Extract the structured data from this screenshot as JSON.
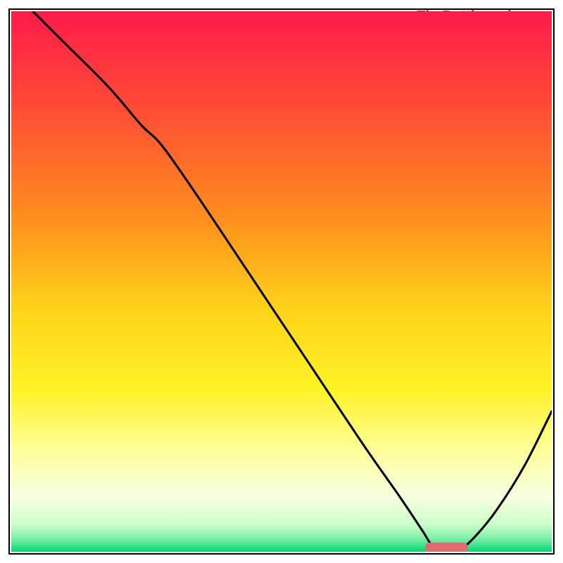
{
  "watermark": "TheBottleneck.com",
  "colors": {
    "frame": "#000000",
    "curve": "#000000",
    "marker": "#e16a6f",
    "gradient_stops": [
      {
        "offset": 0.0,
        "color": "#ff1b4b"
      },
      {
        "offset": 0.18,
        "color": "#ff4c35"
      },
      {
        "offset": 0.38,
        "color": "#ff8e1e"
      },
      {
        "offset": 0.55,
        "color": "#ffd21a"
      },
      {
        "offset": 0.7,
        "color": "#fff326"
      },
      {
        "offset": 0.82,
        "color": "#fdffa0"
      },
      {
        "offset": 0.9,
        "color": "#f6ffe0"
      },
      {
        "offset": 0.95,
        "color": "#c9ffc7"
      },
      {
        "offset": 0.975,
        "color": "#7ff0a8"
      },
      {
        "offset": 1.0,
        "color": "#00d977"
      }
    ]
  },
  "chart_data": {
    "type": "line",
    "title": "",
    "xlabel": "",
    "ylabel": "",
    "xlim": [
      0,
      100
    ],
    "ylim": [
      0,
      100
    ],
    "note": "Single unlabeled curve on a vertical red→green gradient. Values are percentage of plot width (x) and plot height (y, 0 = top). Curve descends from top-left to a flat minimum near x≈78–83 then rises toward the right edge.",
    "series": [
      {
        "name": "curve",
        "x": [
          4,
          10,
          18,
          24,
          28,
          35,
          45,
          55,
          65,
          72,
          76,
          78,
          80,
          83,
          86,
          90,
          95,
          100
        ],
        "y": [
          0,
          6,
          14,
          21,
          25,
          35,
          50,
          65,
          80,
          90,
          96,
          99,
          99.5,
          99.5,
          97,
          92,
          84,
          74
        ]
      }
    ],
    "marker": {
      "comment": "short rounded bar at the curve minimum",
      "x_start": 76.5,
      "x_end": 84.5,
      "y": 99.2,
      "color": "#e16a6f"
    }
  }
}
